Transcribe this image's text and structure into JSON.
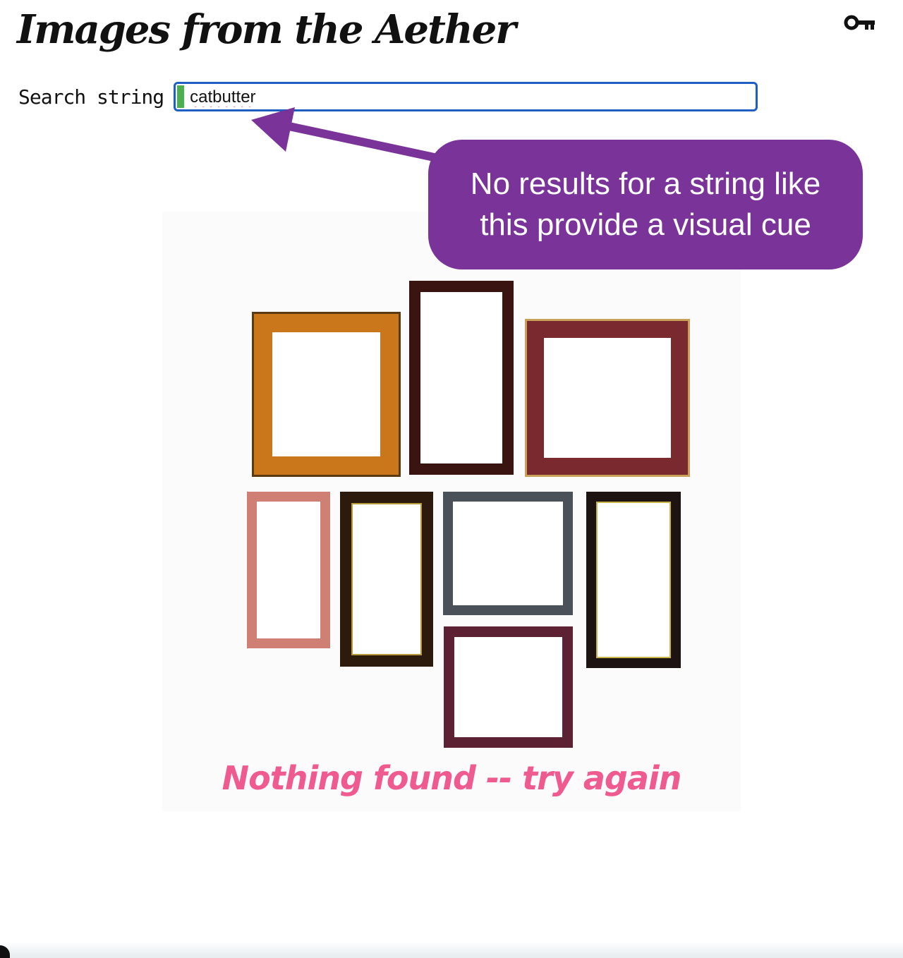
{
  "app": {
    "title": "Images from the Aether"
  },
  "search": {
    "label": "Search string",
    "value": "catbutter",
    "status_color": "#4caf50"
  },
  "callout": {
    "text": "No results for a string like this provide a visual cue",
    "color": "#7a3499"
  },
  "result": {
    "message": "Nothing found -- try again",
    "message_color": "#ef5b8f"
  },
  "icons": {
    "key": "key-icon"
  }
}
